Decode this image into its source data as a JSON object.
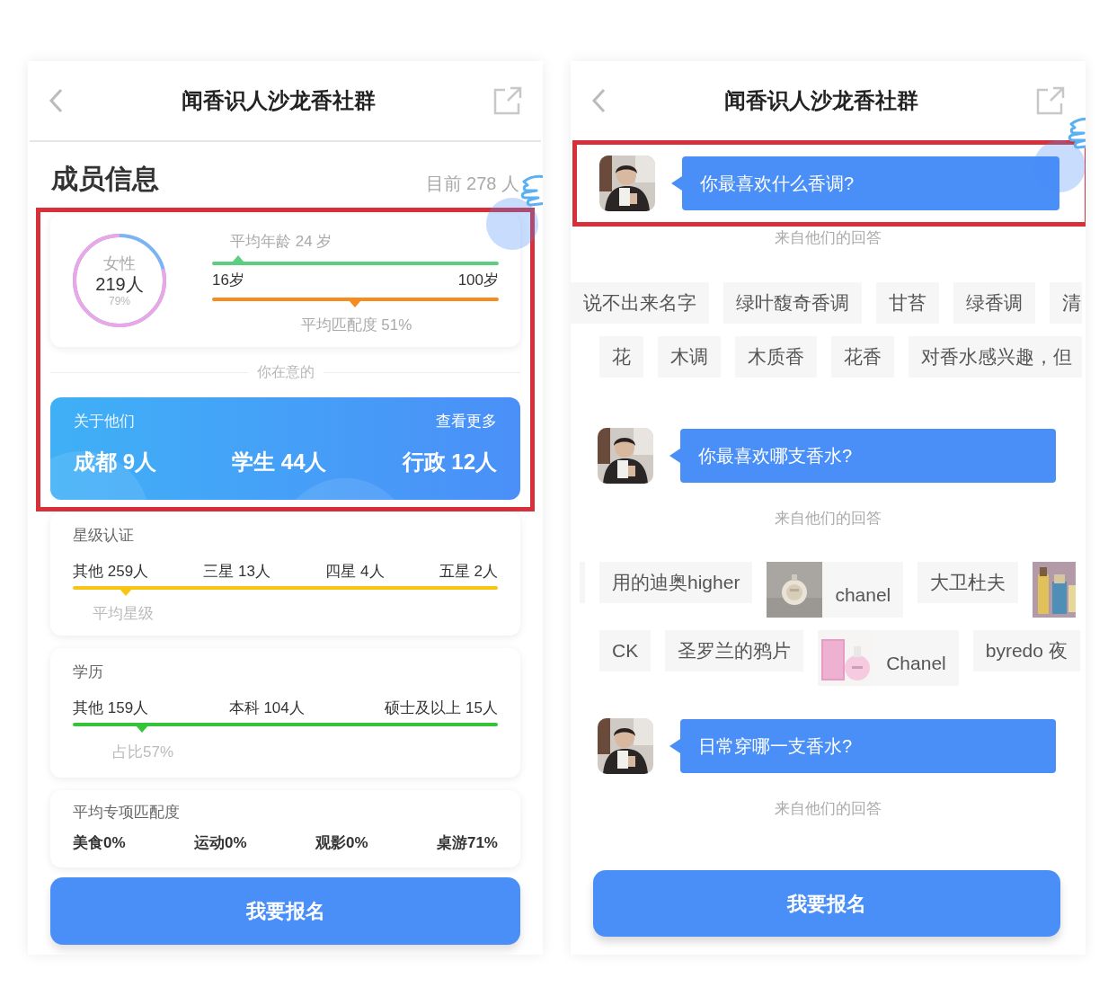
{
  "left_screen": {
    "title": "闻香识人沙龙香社群",
    "section_title": "成员信息",
    "member_count": "目前 278 人",
    "highlight": true,
    "gender": {
      "label": "女性",
      "count": "219人",
      "percent": "79%"
    },
    "age": {
      "average_label": "平均年龄 24 岁",
      "min": "16岁",
      "max": "100岁",
      "match_label": "平均匹配度 51%"
    },
    "divider_label": "你在意的",
    "about": {
      "title": "关于他们",
      "more": "查看更多",
      "stats": [
        "成都 9人",
        "学生 44人",
        "行政 12人"
      ]
    },
    "star_card": {
      "title": "星级认证",
      "items": [
        "其他 259人",
        "三星 13人",
        "四星 4人",
        "五星 2人"
      ],
      "footer": "平均星级"
    },
    "education_card": {
      "title": "学历",
      "items": [
        "其他 159人",
        "本科 104人",
        "硕士及以上 15人"
      ],
      "footer": "占比57%"
    },
    "match_card": {
      "title": "平均专项匹配度",
      "items": [
        "美食0%",
        "运动0%",
        "观影0%",
        "桌游71%"
      ]
    },
    "signup_button": "我要报名"
  },
  "right_screen": {
    "title": "闻香识人沙龙香社群",
    "questions": [
      {
        "text": "你最喜欢什么香调?",
        "highlight": true,
        "answers_label": "来自他们的回答",
        "tag_rows": [
          [
            {
              "kind": "text",
              "text": "说不出来名字"
            },
            {
              "kind": "text",
              "text": "绿叶馥奇香调"
            },
            {
              "kind": "text",
              "text": "甘苔"
            },
            {
              "kind": "text",
              "text": "绿香调"
            },
            {
              "kind": "text",
              "text": "清"
            }
          ],
          [
            {
              "kind": "text",
              "text": "花"
            },
            {
              "kind": "text",
              "text": "木调"
            },
            {
              "kind": "text",
              "text": "木质香"
            },
            {
              "kind": "text",
              "text": "花香"
            },
            {
              "kind": "text",
              "text": "对香水感兴趣，但"
            }
          ]
        ]
      },
      {
        "text": "你最喜欢哪支香水?",
        "highlight": false,
        "answers_label": "来自他们的回答",
        "tag_rows": [
          [
            {
              "kind": "text",
              "text": "用的迪奥higher"
            },
            {
              "text": "chanel"
            },
            {
              "kind": "text",
              "text": "大卫杜夫"
            },
            {
              "kind": "photo_only"
            }
          ],
          [
            {
              "kind": "text",
              "text": "CK"
            },
            {
              "kind": "text",
              "text": "圣罗兰的鸦片"
            },
            {
              "text": "Chanel"
            },
            {
              "kind": "text",
              "text": "byredo 夜"
            }
          ]
        ]
      },
      {
        "text": "日常穿哪一支香水?",
        "highlight": false,
        "answers_label": "来自他们的回答"
      }
    ],
    "signup_button": "我要报名"
  }
}
